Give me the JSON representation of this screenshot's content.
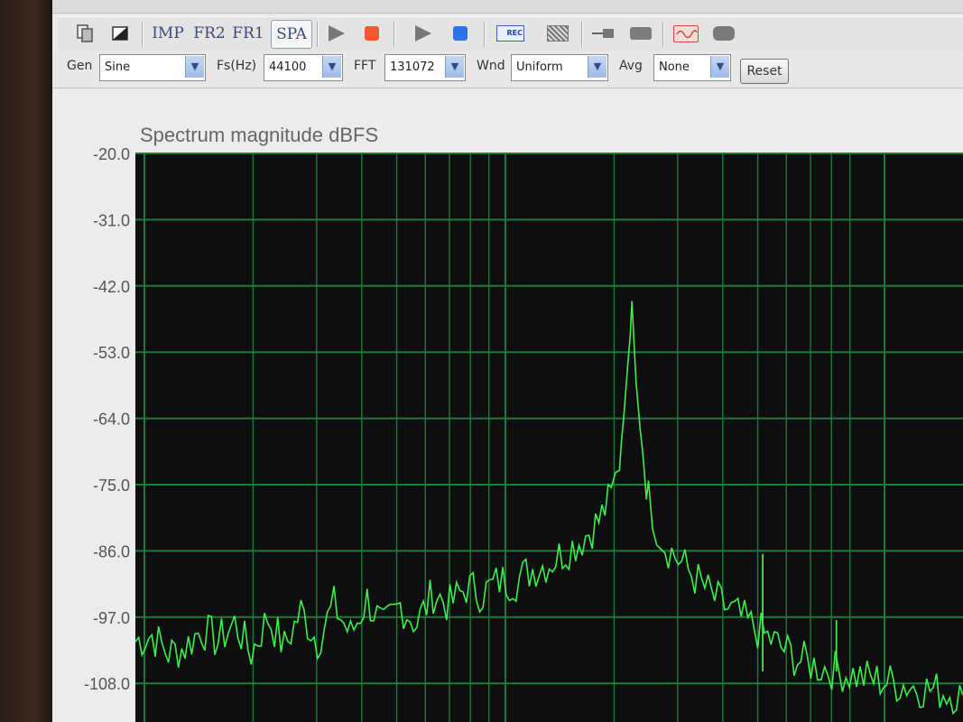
{
  "toolbar": {
    "imp_label": "IMP",
    "fr2_label": "FR2",
    "fr1_label": "FR1",
    "spa_label": "SPA"
  },
  "controls": {
    "gen_label": "Gen",
    "gen_value": "Sine",
    "fs_label": "Fs(Hz)",
    "fs_value": "44100",
    "fft_label": "FFT",
    "fft_value": "131072",
    "wnd_label": "Wnd",
    "wnd_value": "Uniform",
    "avg_label": "Avg",
    "avg_value": "None",
    "reset_label": "Reset"
  },
  "colors": {
    "plot_bg": "#0e0d10",
    "grid": "#1f7a3a",
    "trace": "#3cf04a"
  },
  "chart_data": {
    "type": "line",
    "title": "Spectrum magnitude dBFS",
    "xlabel": "",
    "ylabel": "",
    "x_scale": "log",
    "ylim": [
      -108.0,
      -20.0
    ],
    "y_ticks": [
      "-20.0",
      "-31.0",
      "-42.0",
      "-53.0",
      "-64.0",
      "-75.0",
      "-86.0",
      "-97.0",
      "-108.0"
    ],
    "grid": true,
    "series": [
      {
        "points": [
          [
            0.0,
            -101
          ],
          [
            0.02,
            -100
          ],
          [
            0.04,
            -103
          ],
          [
            0.06,
            -102
          ],
          [
            0.08,
            -99
          ],
          [
            0.1,
            -101
          ],
          [
            0.12,
            -98
          ],
          [
            0.14,
            -103
          ],
          [
            0.16,
            -97
          ],
          [
            0.18,
            -102
          ],
          [
            0.2,
            -96
          ],
          [
            0.22,
            -101
          ],
          [
            0.24,
            -95
          ],
          [
            0.26,
            -100
          ],
          [
            0.28,
            -94
          ],
          [
            0.3,
            -99
          ],
          [
            0.32,
            -95
          ],
          [
            0.34,
            -98
          ],
          [
            0.36,
            -93
          ],
          [
            0.38,
            -95
          ],
          [
            0.4,
            -92
          ],
          [
            0.42,
            -93
          ],
          [
            0.44,
            -91
          ],
          [
            0.46,
            -91
          ],
          [
            0.48,
            -89
          ],
          [
            0.5,
            -88
          ],
          [
            0.52,
            -86
          ],
          [
            0.54,
            -84
          ],
          [
            0.56,
            -81
          ],
          [
            0.575,
            -77
          ],
          [
            0.585,
            -71
          ],
          [
            0.59,
            -64
          ],
          [
            0.595,
            -55
          ],
          [
            0.598,
            -50
          ],
          [
            0.6,
            -44.5
          ],
          [
            0.602,
            -50
          ],
          [
            0.605,
            -58
          ],
          [
            0.61,
            -66
          ],
          [
            0.615,
            -72
          ],
          [
            0.62,
            -77
          ],
          [
            0.63,
            -82
          ],
          [
            0.64,
            -85
          ],
          [
            0.66,
            -88
          ],
          [
            0.68,
            -91
          ],
          [
            0.7,
            -94
          ],
          [
            0.72,
            -96
          ],
          [
            0.74,
            -98
          ],
          [
            0.76,
            -100
          ],
          [
            0.78,
            -102
          ],
          [
            0.8,
            -104
          ],
          [
            0.82,
            -105
          ],
          [
            0.85,
            -106
          ],
          [
            0.88,
            -107
          ],
          [
            0.92,
            -108
          ],
          [
            0.96,
            -109
          ],
          [
            1.0,
            -110
          ]
        ]
      }
    ],
    "spurs": [
      [
        0.758,
        -86.5
      ],
      [
        0.847,
        -97.5
      ]
    ]
  }
}
